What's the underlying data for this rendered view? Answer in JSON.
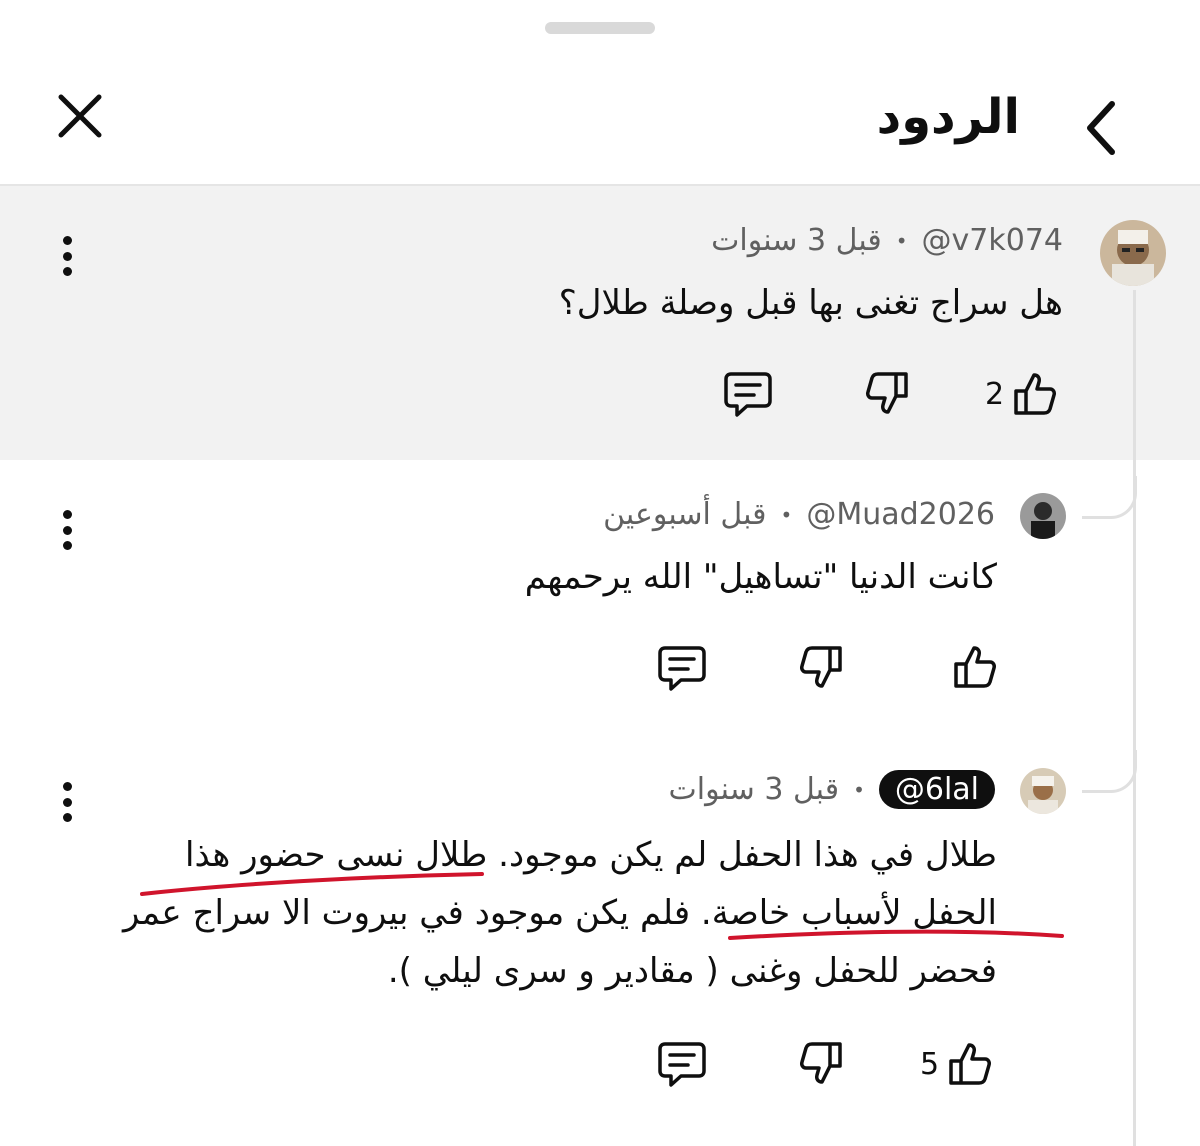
{
  "header": {
    "title": "الردود"
  },
  "comments": [
    {
      "handle": "@v7k074",
      "time": "قبل 3 سنوات",
      "text": "هل سراج تغنى بها قبل وصلة طلال؟",
      "likes": "2"
    },
    {
      "handle": "@Muad2026",
      "time": "قبل أسبوعين",
      "text": "كانت الدنيا \"تساهيل\" الله يرحمهم",
      "likes": ""
    },
    {
      "handle": "@6lal",
      "time": "قبل 3 سنوات",
      "text_lines": [
        "طلال في هذا الحفل لم يكن موجود. طلال نسى حضور هذا",
        "الحفل لأسباب خاصة. فلم يكن موجود في بيروت الا سراج عمر",
        "فحضر للحفل وغنى ( مقادير و سرى ليلي )."
      ],
      "likes": "5"
    }
  ],
  "colors": {
    "highlight_bg": "#f2f2f2",
    "annotation_red": "#d0142c",
    "thread_line": "#e0e0e0"
  },
  "icons": [
    "chevron-back-icon",
    "close-icon",
    "like-icon",
    "dislike-icon",
    "reply-icon",
    "more-vert-icon"
  ]
}
